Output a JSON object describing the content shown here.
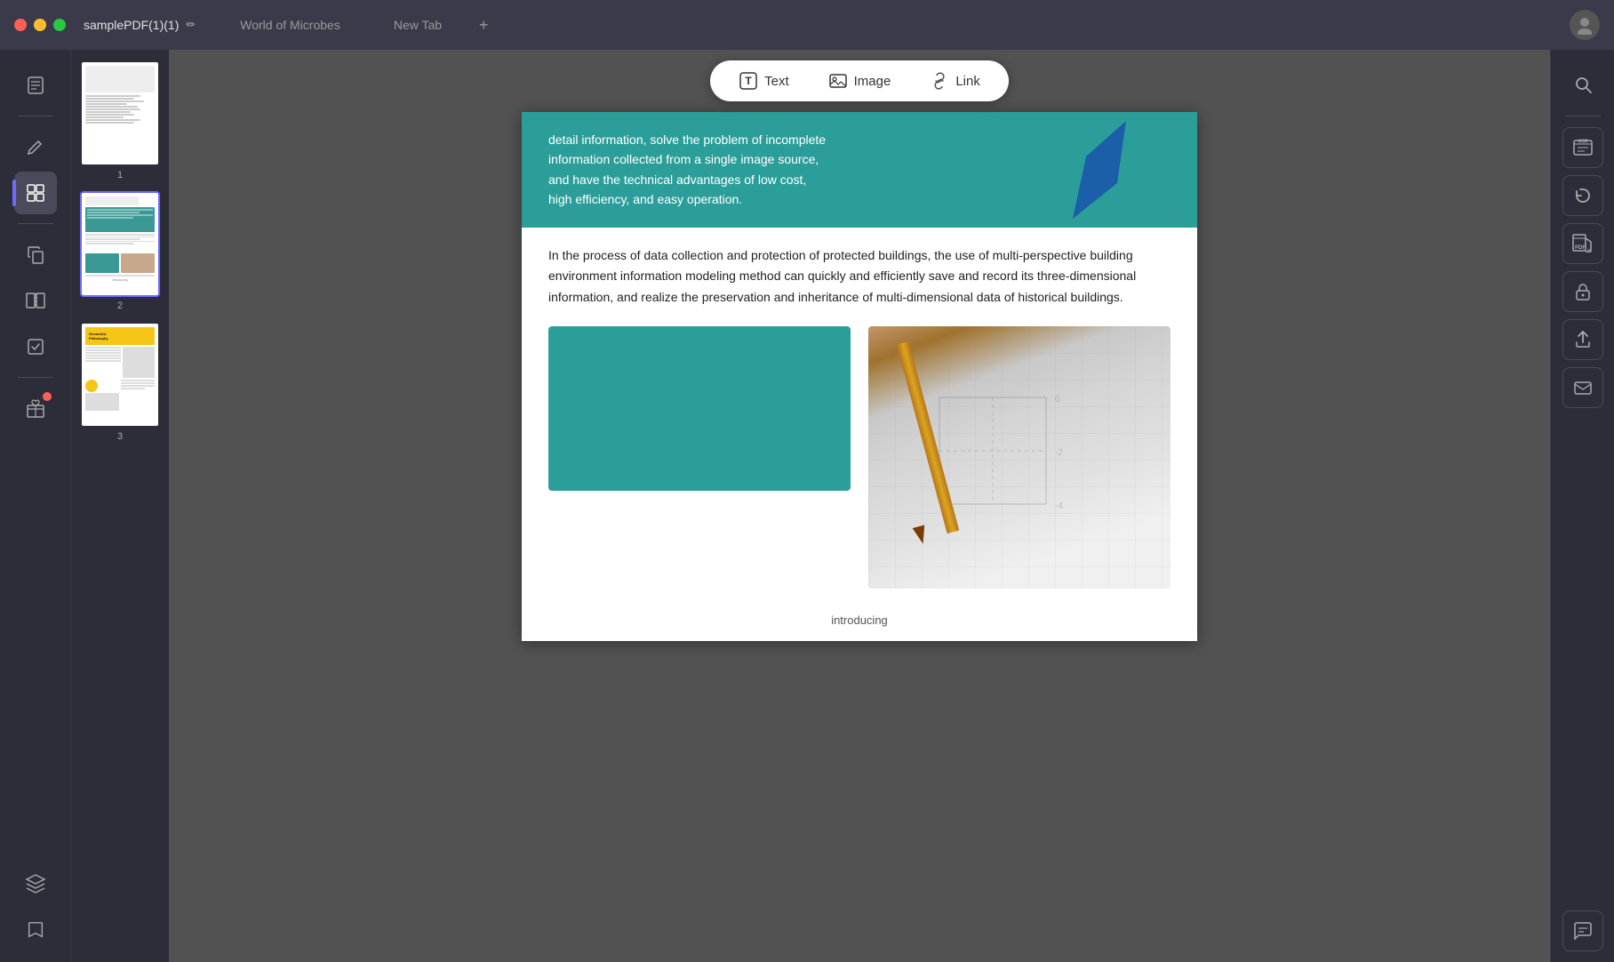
{
  "titlebar": {
    "traffic_lights": [
      "close",
      "minimize",
      "maximize"
    ],
    "active_tab": "samplePDF(1)(1)",
    "edit_icon": "✏",
    "tabs": [
      {
        "label": "samplePDF(1)(1)",
        "active": true
      },
      {
        "label": "World of Microbes",
        "active": false
      },
      {
        "label": "New Tab",
        "active": false
      }
    ],
    "new_tab_icon": "+",
    "avatar_icon": "👤"
  },
  "left_sidebar": {
    "icons": [
      {
        "name": "reader-icon",
        "symbol": "📖",
        "active": false
      },
      {
        "name": "annotate-icon",
        "symbol": "✏️",
        "active": false
      },
      {
        "name": "thumbnail-icon",
        "symbol": "⊞",
        "active": true
      },
      {
        "name": "copy-icon",
        "symbol": "❐",
        "active": false
      },
      {
        "name": "layers-icon",
        "symbol": "⊕",
        "active": false
      },
      {
        "name": "bookmark-icon",
        "symbol": "🔖",
        "active": false
      },
      {
        "name": "gift-icon",
        "symbol": "🎁",
        "active": false,
        "badge": true
      }
    ]
  },
  "toolbar": {
    "text_label": "Text",
    "image_label": "Image",
    "link_label": "Link",
    "text_icon": "T",
    "image_icon": "🖼",
    "link_icon": "🔗"
  },
  "thumbnails": [
    {
      "number": "1"
    },
    {
      "number": "2",
      "selected": true
    },
    {
      "number": "3"
    }
  ],
  "pdf_page2": {
    "top_text": "detail information, solve the problem of incomplete information collected from a single image source, and have the technical advantages of low cost, high efficiency, and easy operation.",
    "description": "In the process of data collection and protection of protected buildings, the use of multi-perspective building environment information modeling method can quickly and efficiently save and record its three-dimensional information, and realize the preservation and inheritance of multi-dimensional data of historical buildings.",
    "caption": "introducing"
  },
  "right_sidebar": {
    "icons": [
      {
        "name": "search-icon",
        "symbol": "🔍"
      },
      {
        "name": "ocr-icon",
        "label": "OCR"
      },
      {
        "name": "rotate-icon",
        "symbol": "↻"
      },
      {
        "name": "pdf-a-icon",
        "label": "PDF/A"
      },
      {
        "name": "lock-icon",
        "symbol": "🔒"
      },
      {
        "name": "share-icon",
        "symbol": "↑"
      },
      {
        "name": "sign-icon",
        "symbol": "✉"
      },
      {
        "name": "comment-icon",
        "symbol": "💬"
      }
    ]
  }
}
